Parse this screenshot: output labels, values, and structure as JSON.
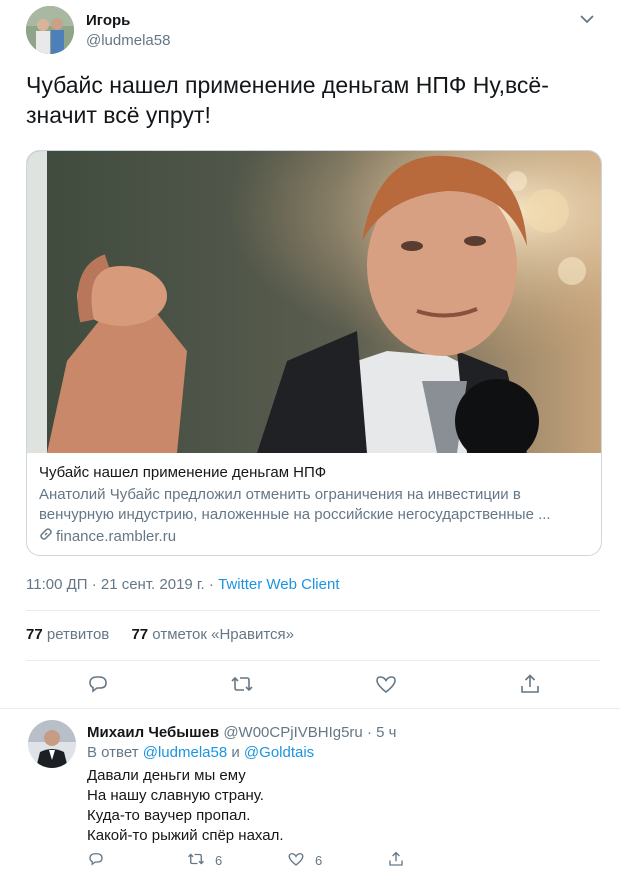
{
  "tweet": {
    "author_name": "Игорь",
    "author_handle": "@ludmela58",
    "text": "Чубайс нашел применение деньгам НПФ Ну,всё- значит всё упрут!",
    "card": {
      "title": "Чубайс нашел применение деньгам НПФ",
      "description": "Анатолий Чубайс предложил отменить ограничения на инвестиции в венчурную индустрию, наложенные на российские негосударственные ...",
      "domain": "finance.rambler.ru"
    },
    "time_date": "11:00 ДП · 21 сент. 2019 г. · ",
    "client": "Twitter Web Client",
    "retweets_count": "77",
    "retweets_label": " ретвитов",
    "likes_count": "77",
    "likes_label": " отметок «Нравится»"
  },
  "reply": {
    "author_name": "Михаил Чебышев",
    "author_handle": "@W00CPjIVBHIg5ru",
    "time": " · 5 ч",
    "in_reply_prefix": "В ответ ",
    "mention_1": "@ludmela58",
    "conj": " и ",
    "mention_2": "@Goldtais",
    "lines": [
      "Давали деньги мы ему",
      "На нашу славную страну.",
      "Куда-то ваучер пропал.",
      "Какой-то рыжий спёр нахал."
    ],
    "retweet_count": "6",
    "like_count": "6"
  },
  "colors": {
    "accent": "#1b95e0",
    "secondary_text": "#657786",
    "border": "#e6ecf0"
  },
  "icons": [
    "chevron-down-icon",
    "link-icon",
    "reply-icon",
    "retweet-icon",
    "like-icon",
    "share-icon"
  ]
}
